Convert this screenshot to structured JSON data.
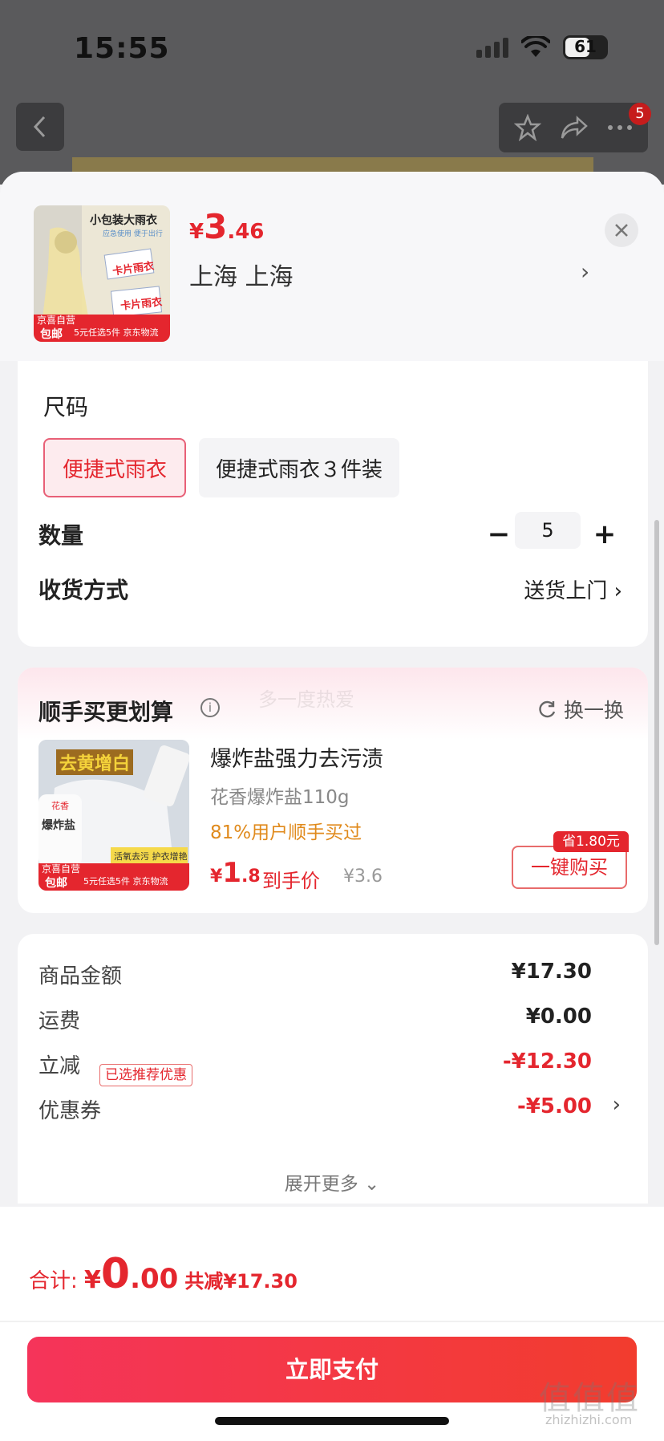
{
  "status": {
    "time": "15:55",
    "battery": "61"
  },
  "nav": {
    "badge_count": "5"
  },
  "product": {
    "thumb_title": "小包装大雨衣",
    "thumb_subtitle": "应急使用 便于出行",
    "thumb_card1": "卡片雨衣",
    "thumb_card2": "卡片雨衣",
    "thumb_tag1": "京喜自营",
    "thumb_tag2": "包邮",
    "thumb_banner": "5元任选5件 京东物流",
    "price_symbol": "¥",
    "price_int": "3",
    "price_dec": ".46",
    "location": "上海  上海",
    "location_arrow": "›"
  },
  "specs": {
    "size_label": "尺码",
    "options": [
      "便捷式雨衣",
      "便捷式雨衣３件装"
    ],
    "quantity_label": "数量",
    "quantity_value": "5",
    "minus": "−",
    "plus": "+",
    "delivery_label": "收货方式",
    "delivery_value": "送货上门 ›"
  },
  "recommend": {
    "title": "顺手买更划算",
    "watermark": "多一度热爱",
    "refresh_label": "换一换",
    "item_name": "爆炸盐强力去污渍",
    "item_sub": "花香爆炸盐110g",
    "item_bought": "81%用户顺手买过",
    "price_symbol": "¥",
    "price_int": "1",
    "price_dec": ".8",
    "final_label": "到手价",
    "orig_price": "¥3.6",
    "buy_label": "一键购买",
    "save_tag": "省1.80元",
    "thumb_title": "去黄增白",
    "thumb_label1": "花香",
    "thumb_label2": "爆炸盐",
    "thumb_strip": "活氧去污 护衣增艳",
    "thumb_tag1": "京喜自营",
    "thumb_tag2": "包邮",
    "thumb_banner": "5元任选5件 京东物流"
  },
  "fees": {
    "goods_label": "商品金额",
    "goods_value": "¥17.30",
    "shipping_label": "运费",
    "shipping_value": "¥0.00",
    "discount_label": "立减",
    "discount_value": "-¥12.30",
    "coupon_label": "优惠券",
    "coupon_tag": "已选推荐优惠",
    "coupon_value": "-¥5.00",
    "expand_label": "展开更多 ⌄"
  },
  "footer": {
    "total_label": "合计: ",
    "total_symbol": "¥",
    "total_int": "0",
    "total_dec": ".00",
    "saved": "共减¥17.30",
    "pay_label": "立即支付"
  },
  "watermark_corner": {
    "text": "值值值",
    "sub": "zhizhizhi.com"
  }
}
